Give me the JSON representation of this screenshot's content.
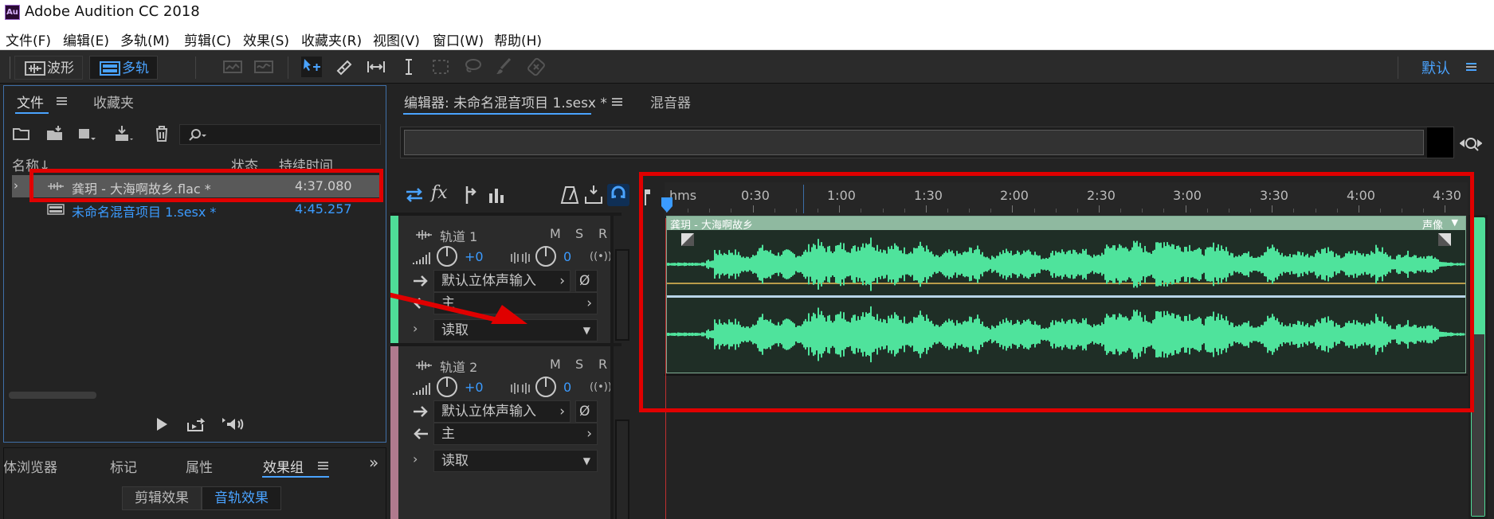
{
  "window": {
    "logo": "Au",
    "title": "Adobe Audition CC 2018"
  },
  "menu": [
    "文件(F)",
    "编辑(E)",
    "多轨(M)",
    "剪辑(C)",
    "效果(S)",
    "收藏夹(R)",
    "视图(V)",
    "窗口(W)",
    "帮助(H)"
  ],
  "toolbar": {
    "waveform_label": "波形",
    "multitrack_label": "多轨",
    "workspace_label": "默认"
  },
  "files_panel": {
    "tab_files": "文件",
    "tab_favorites": "收藏夹",
    "search_placeholder": "",
    "col_name": "名称",
    "col_status": "状态",
    "col_duration": "持续时间",
    "rows": [
      {
        "name": "龚玥 - 大海啊故乡.flac *",
        "duration": "4:37.080"
      },
      {
        "name": "未命名混音项目 1.sesx *",
        "duration": "4:45.257"
      }
    ]
  },
  "bottom_panel": {
    "tabs": [
      "媒体浏览器",
      "标记",
      "属性",
      "效果组"
    ],
    "subtabs": [
      "剪辑效果",
      "音轨效果"
    ]
  },
  "editor": {
    "tab_editor": "编辑器: 未命名混音项目 1.sesx *",
    "tab_mixer": "混音器",
    "ruler_unit": "hms",
    "ruler_labels": [
      "0:30",
      "1:00",
      "1:30",
      "2:00",
      "2:30",
      "3:00",
      "3:30",
      "4:00",
      "4:30"
    ]
  },
  "tracks": [
    {
      "name": "轨道 1",
      "m": "M",
      "s": "S",
      "r": "R",
      "vol": "+0",
      "pan": "0",
      "input": "默认立体声输入",
      "output": "主",
      "automation": "读取",
      "color": "#4fdc98"
    },
    {
      "name": "轨道 2",
      "m": "M",
      "s": "S",
      "r": "R",
      "vol": "+0",
      "pan": "0",
      "input": "默认立体声输入",
      "output": "主",
      "automation": "读取",
      "color": "#b07a8e"
    }
  ],
  "clip": {
    "title": "龚玥 - 大海啊故乡",
    "label": "声像",
    "color": "#4fe39c"
  }
}
